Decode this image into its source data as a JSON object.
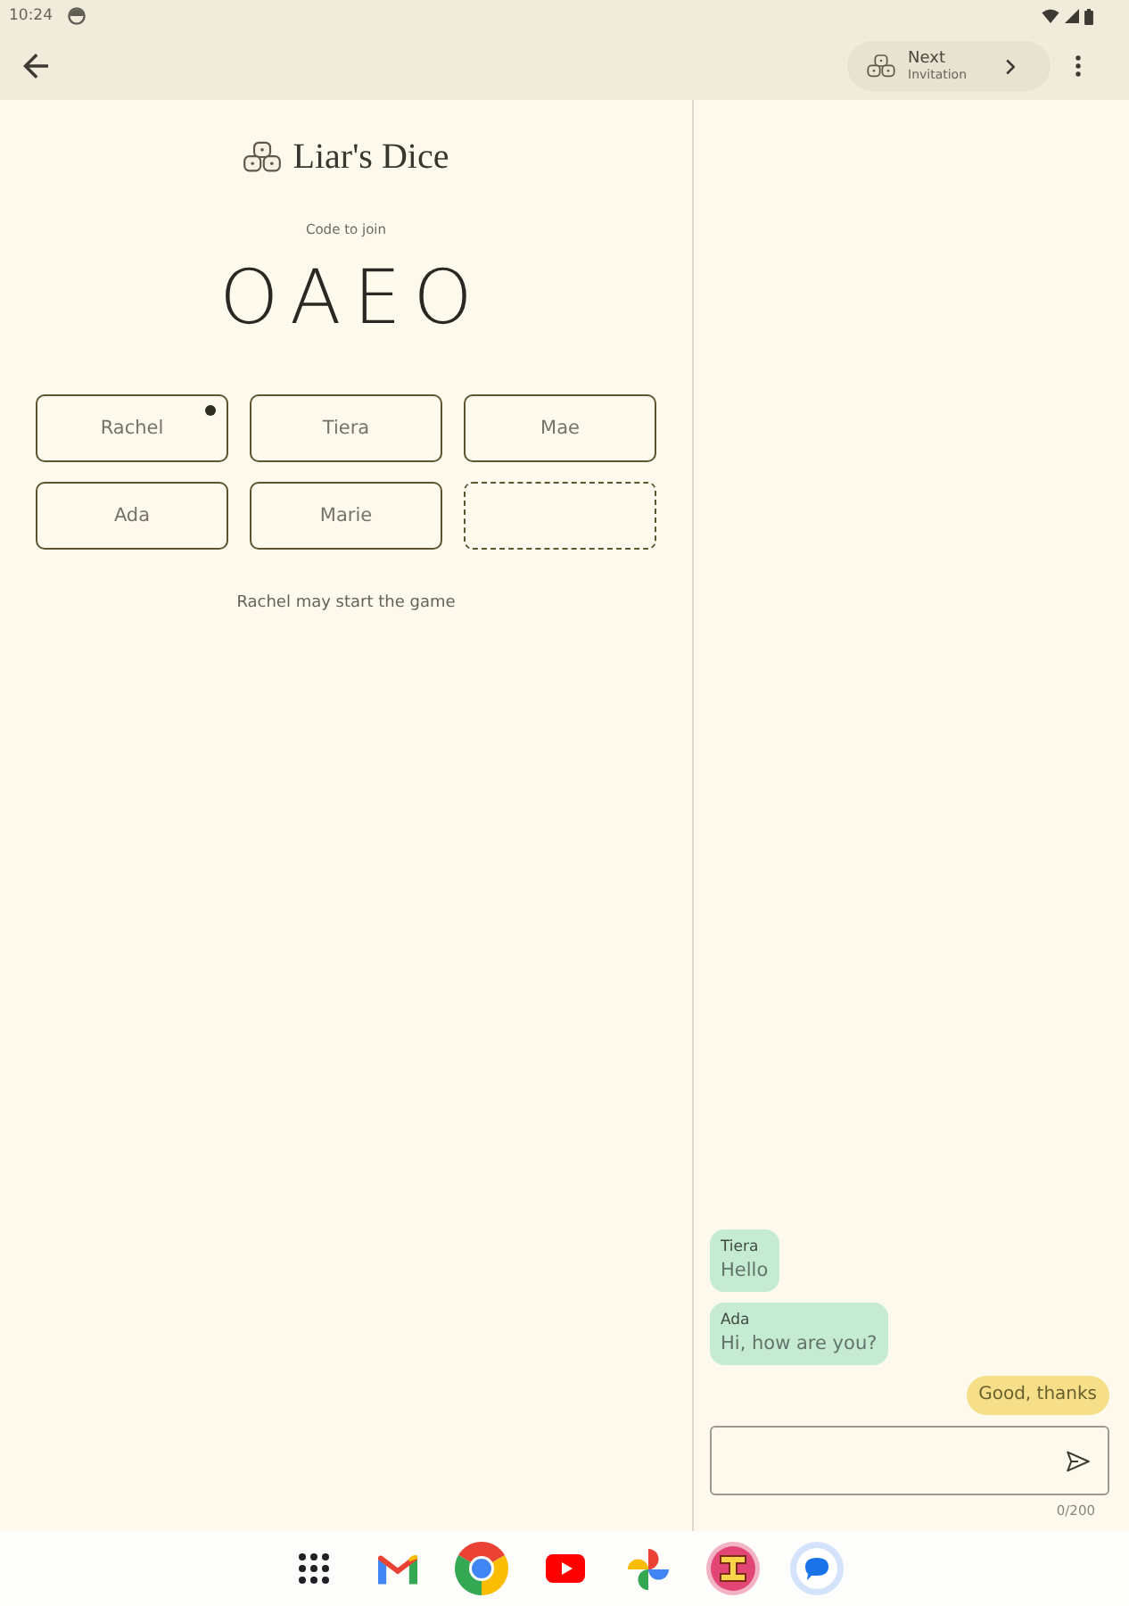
{
  "status_bar": {
    "time": "10:24"
  },
  "app_bar": {
    "action": {
      "title": "Next",
      "subtitle": "Invitation"
    }
  },
  "game": {
    "title": "Liar's Dice",
    "code_label": "Code to join",
    "code": "OAEO",
    "slots": [
      {
        "kind": "player",
        "name": "Rachel",
        "host": true
      },
      {
        "kind": "player",
        "name": "Tiera",
        "host": false
      },
      {
        "kind": "player",
        "name": "Mae",
        "host": false
      },
      {
        "kind": "player",
        "name": "Ada",
        "host": false
      },
      {
        "kind": "player",
        "name": "Marie",
        "host": false
      },
      {
        "kind": "empty"
      }
    ],
    "status": "Rachel may start the game"
  },
  "chat": {
    "messages": [
      {
        "kind": "received",
        "sender": "Tiera",
        "text": "Hello"
      },
      {
        "kind": "received",
        "sender": "Ada",
        "text": "Hi, how are you?"
      },
      {
        "kind": "sent",
        "text": "Good, thanks"
      }
    ],
    "counter": "0/200"
  }
}
